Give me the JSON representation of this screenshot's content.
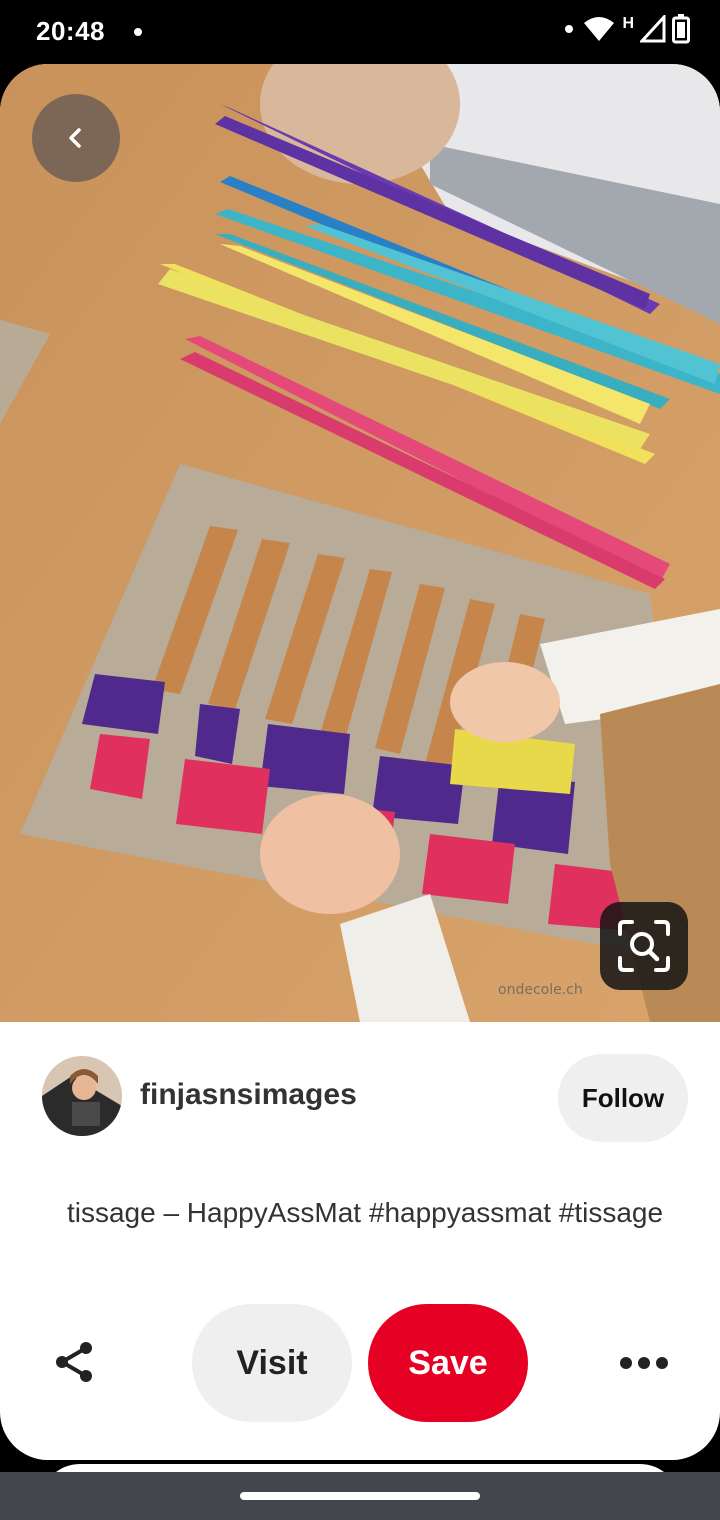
{
  "status_bar": {
    "time": "20:48",
    "network_label": "H"
  },
  "pin": {
    "image_icon": "photo-paper-weaving",
    "watermark": "ondecole.ch",
    "creator": {
      "name": "finjasnsimages",
      "follow_label": "Follow"
    },
    "description": "tissage – HappyAssMat #happyassmat #tissage"
  },
  "actions": {
    "visit_label": "Visit",
    "save_label": "Save"
  },
  "colors": {
    "save_red": "#e60023",
    "button_gray": "#efefef",
    "text_dark": "#333333"
  },
  "icons": [
    "back-arrow-icon",
    "visual-search-icon",
    "share-icon",
    "more-options-icon",
    "wifi-icon",
    "signal-icon",
    "battery-icon"
  ]
}
